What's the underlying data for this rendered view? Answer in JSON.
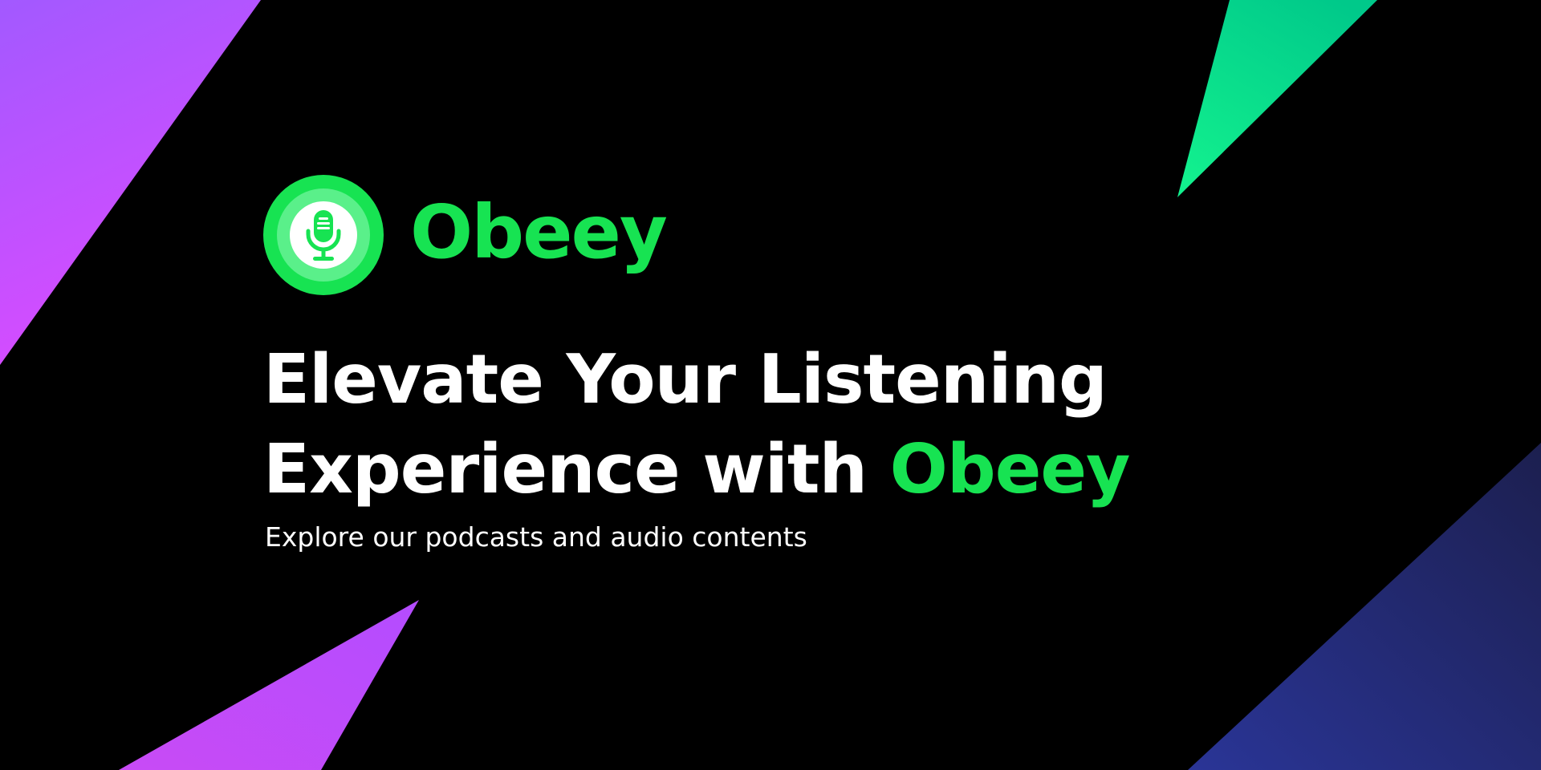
{
  "brand": {
    "name": "Obeey",
    "logo_icon": "microphone-icon"
  },
  "hero": {
    "headline_line1": "Elevate Your Listening",
    "headline_line2_prefix": "Experience with ",
    "headline_line2_accent": "Obeey",
    "subtitle": "Explore our podcasts and audio contents"
  },
  "colors": {
    "background": "#000000",
    "brand_green": "#17E352",
    "text": "#FFFFFF",
    "purple_light": "#A855F7",
    "magenta": "#D946EF",
    "teal_green": "#10D68A",
    "navy": "#1F2A6B"
  }
}
